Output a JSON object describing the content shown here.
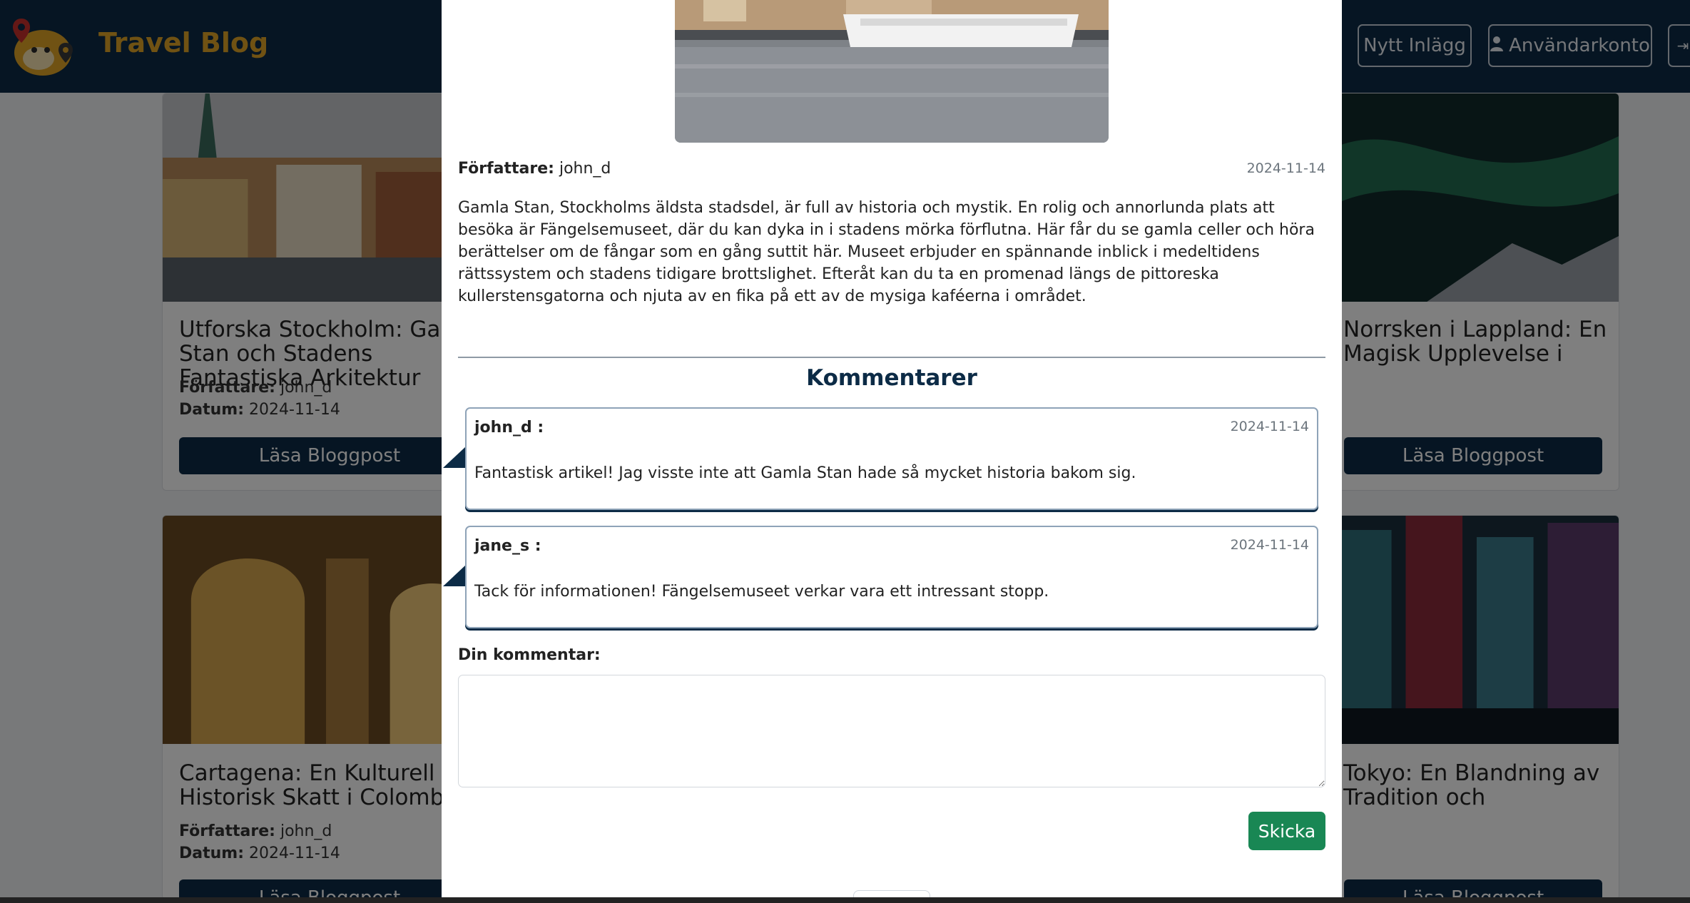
{
  "navbar": {
    "brand": "Travel Blog",
    "new_post": "Nytt Inlägg",
    "account": "Användarkonto"
  },
  "cards": [
    {
      "title": "Utforska Stockholm: Gamla Stan och Stadens Fantastiska Arkitektur",
      "author_label": "Författare:",
      "author": "john_d",
      "date_label": "Datum:",
      "date": "2024-11-14",
      "button": "Läsa Bloggpost"
    },
    {
      "title": "Norrsken i Lappland: En Magisk Upplevelse i",
      "button": "Läsa Bloggpost"
    },
    {
      "title": "Cartagena: En Kulturell och Historisk Skatt i Colombia",
      "author_label": "Författare:",
      "author": "john_d",
      "date_label": "Datum:",
      "date": "2024-11-14",
      "button": "Läsa Bloggpost"
    },
    {
      "title": "Tokyo: En Blandning av Tradition och",
      "button": "Läsa Bloggpost"
    }
  ],
  "modal": {
    "author_label": "Författare:",
    "author": "john_d",
    "date": "2024-11-14",
    "body": "Gamla Stan, Stockholms äldsta stadsdel, är full av historia och mystik. En rolig och annorlunda plats att besöka är Fängelsemuseet, där du kan dyka in i stadens mörka förflutna. Här får du se gamla celler och höra berättelser om de fångar som en gång suttit här. Museet erbjuder en spännande inblick i medeltidens rättssystem och stadens tidigare brottslighet. Efteråt kan du ta en promenad längs de pittoreska kullerstensgatorna och njuta av en fika på ett av de mysiga kaféerna i området.",
    "comments_heading": "Kommentarer",
    "comments": [
      {
        "user": "john_d :",
        "date": "2024-11-14",
        "text": "Fantastisk artikel! Jag visste inte att Gamla Stan hade så mycket historia bakom sig."
      },
      {
        "user": "jane_s :",
        "date": "2024-11-14",
        "text": "Tack för informationen! Fängelsemuseet verkar vara ett intressant stopp."
      }
    ],
    "your_comment_label": "Din kommentar:",
    "submit": "Skicka"
  },
  "colors": {
    "navy": "#0c2b46",
    "brand_gold": "#e0a526",
    "submit_green": "#198754"
  }
}
